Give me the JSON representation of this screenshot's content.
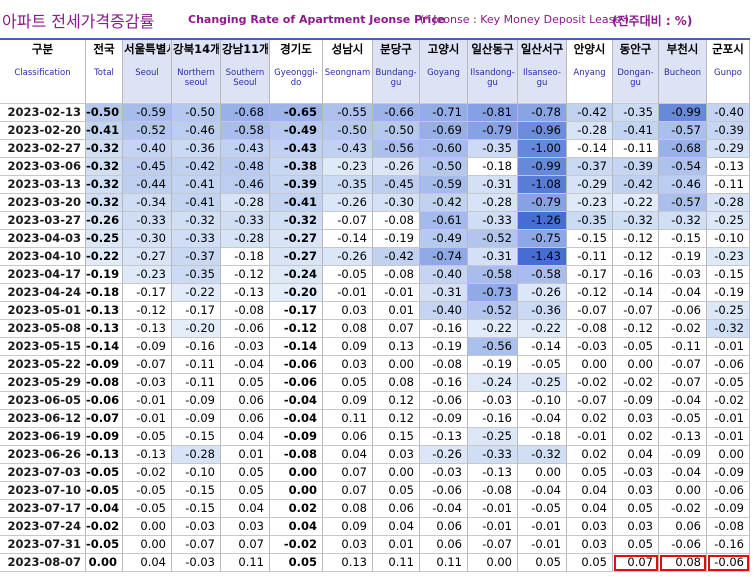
{
  "title": {
    "korean": "아파트 전세가격증감률",
    "english": "Changing Rate of Apartment Jeonse Price",
    "note": "(* Jeonse : Key Money Deposit Lease )",
    "unit": "(전주대비 : %)"
  },
  "colors": {
    "title": "#8b1a8b",
    "header_border": "#4a5fb8",
    "highlight_box": "#e01010"
  },
  "columns": [
    {
      "kr": "구분",
      "en": "Classification"
    },
    {
      "kr": "전국",
      "en": "Total"
    },
    {
      "kr": "서울특별시",
      "en": "Seoul"
    },
    {
      "kr": "강북14개구",
      "en": "Northern seoul"
    },
    {
      "kr": "강남11개구",
      "en": "Southern Seoul"
    },
    {
      "kr": "경기도",
      "en": "Gyeonggi-do"
    },
    {
      "kr": "성남시",
      "en": "Seongnam"
    },
    {
      "kr": "분당구",
      "en": "Bundang-gu"
    },
    {
      "kr": "고양시",
      "en": "Goyang"
    },
    {
      "kr": "일산동구",
      "en": "Ilsandong-gu"
    },
    {
      "kr": "일산서구",
      "en": "Ilsanseo-gu"
    },
    {
      "kr": "안양시",
      "en": "Anyang"
    },
    {
      "kr": "동안구",
      "en": "Dongan-gu"
    },
    {
      "kr": "부천시",
      "en": "Bucheon"
    },
    {
      "kr": "군포시",
      "en": "Gunpo"
    }
  ],
  "rows": [
    {
      "date": "2023-02-13",
      "v": [
        "-0.50",
        "-0.59",
        "-0.50",
        "-0.68",
        "-0.65",
        "-0.55",
        "-0.66",
        "-0.71",
        "-0.81",
        "-0.78",
        "-0.42",
        "-0.35",
        "-0.99",
        "-0.40"
      ]
    },
    {
      "date": "2023-02-20",
      "v": [
        "-0.41",
        "-0.52",
        "-0.46",
        "-0.58",
        "-0.49",
        "-0.50",
        "-0.50",
        "-0.69",
        "-0.79",
        "-0.96",
        "-0.28",
        "-0.41",
        "-0.57",
        "-0.39"
      ]
    },
    {
      "date": "2023-02-27",
      "v": [
        "-0.32",
        "-0.40",
        "-0.36",
        "-0.43",
        "-0.43",
        "-0.43",
        "-0.56",
        "-0.60",
        "-0.35",
        "-1.00",
        "-0.14",
        "-0.11",
        "-0.68",
        "-0.29"
      ]
    },
    {
      "date": "2023-03-06",
      "v": [
        "-0.32",
        "-0.45",
        "-0.42",
        "-0.48",
        "-0.38",
        "-0.23",
        "-0.26",
        "-0.50",
        "-0.18",
        "-0.99",
        "-0.37",
        "-0.39",
        "-0.54",
        "-0.13"
      ]
    },
    {
      "date": "2023-03-13",
      "v": [
        "-0.32",
        "-0.44",
        "-0.41",
        "-0.46",
        "-0.39",
        "-0.35",
        "-0.45",
        "-0.59",
        "-0.31",
        "-1.08",
        "-0.29",
        "-0.42",
        "-0.46",
        "-0.11"
      ]
    },
    {
      "date": "2023-03-20",
      "v": [
        "-0.32",
        "-0.34",
        "-0.41",
        "-0.28",
        "-0.41",
        "-0.26",
        "-0.30",
        "-0.42",
        "-0.28",
        "-0.79",
        "-0.23",
        "-0.22",
        "-0.57",
        "-0.28"
      ]
    },
    {
      "date": "2023-03-27",
      "v": [
        "-0.26",
        "-0.33",
        "-0.32",
        "-0.33",
        "-0.32",
        "-0.07",
        "-0.08",
        "-0.61",
        "-0.33",
        "-1.26",
        "-0.35",
        "-0.32",
        "-0.32",
        "-0.25"
      ]
    },
    {
      "date": "2023-04-03",
      "v": [
        "-0.25",
        "-0.30",
        "-0.33",
        "-0.28",
        "-0.27",
        "-0.14",
        "-0.19",
        "-0.49",
        "-0.52",
        "-0.75",
        "-0.15",
        "-0.12",
        "-0.15",
        "-0.10"
      ]
    },
    {
      "date": "2023-04-10",
      "v": [
        "-0.22",
        "-0.27",
        "-0.37",
        "-0.18",
        "-0.27",
        "-0.26",
        "-0.42",
        "-0.74",
        "-0.31",
        "-1.43",
        "-0.11",
        "-0.12",
        "-0.19",
        "-0.23"
      ]
    },
    {
      "date": "2023-04-17",
      "v": [
        "-0.19",
        "-0.23",
        "-0.35",
        "-0.12",
        "-0.24",
        "-0.05",
        "-0.08",
        "-0.40",
        "-0.58",
        "-0.58",
        "-0.17",
        "-0.16",
        "-0.03",
        "-0.15"
      ]
    },
    {
      "date": "2023-04-24",
      "v": [
        "-0.18",
        "-0.17",
        "-0.22",
        "-0.13",
        "-0.20",
        "-0.01",
        "-0.01",
        "-0.31",
        "-0.73",
        "-0.26",
        "-0.12",
        "-0.14",
        "-0.04",
        "-0.19"
      ]
    },
    {
      "date": "2023-05-01",
      "v": [
        "-0.13",
        "-0.12",
        "-0.17",
        "-0.08",
        "-0.17",
        "0.03",
        "0.01",
        "-0.40",
        "-0.52",
        "-0.36",
        "-0.07",
        "-0.07",
        "-0.06",
        "-0.25"
      ]
    },
    {
      "date": "2023-05-08",
      "v": [
        "-0.13",
        "-0.13",
        "-0.20",
        "-0.06",
        "-0.12",
        "0.08",
        "0.07",
        "-0.16",
        "-0.22",
        "-0.22",
        "-0.08",
        "-0.12",
        "-0.02",
        "-0.32"
      ]
    },
    {
      "date": "2023-05-15",
      "v": [
        "-0.14",
        "-0.09",
        "-0.16",
        "-0.03",
        "-0.14",
        "0.09",
        "0.13",
        "-0.19",
        "-0.56",
        "-0.14",
        "-0.03",
        "-0.05",
        "-0.11",
        "-0.01"
      ]
    },
    {
      "date": "2023-05-22",
      "v": [
        "-0.09",
        "-0.07",
        "-0.11",
        "-0.04",
        "-0.06",
        "0.03",
        "0.00",
        "-0.08",
        "-0.19",
        "-0.05",
        "0.00",
        "0.00",
        "-0.07",
        "-0.06"
      ]
    },
    {
      "date": "2023-05-29",
      "v": [
        "-0.08",
        "-0.03",
        "-0.11",
        "0.05",
        "-0.06",
        "0.05",
        "0.08",
        "-0.16",
        "-0.24",
        "-0.25",
        "-0.02",
        "-0.02",
        "-0.07",
        "-0.05"
      ]
    },
    {
      "date": "2023-06-05",
      "v": [
        "-0.06",
        "-0.01",
        "-0.09",
        "0.06",
        "-0.04",
        "0.09",
        "0.12",
        "-0.06",
        "-0.03",
        "-0.10",
        "-0.07",
        "-0.09",
        "-0.04",
        "-0.02"
      ]
    },
    {
      "date": "2023-06-12",
      "v": [
        "-0.07",
        "-0.01",
        "-0.09",
        "0.06",
        "-0.04",
        "0.11",
        "0.12",
        "-0.09",
        "-0.16",
        "-0.04",
        "0.02",
        "0.03",
        "-0.05",
        "-0.01"
      ]
    },
    {
      "date": "2023-06-19",
      "v": [
        "-0.09",
        "-0.05",
        "-0.15",
        "0.04",
        "-0.09",
        "0.06",
        "0.15",
        "-0.13",
        "-0.25",
        "-0.18",
        "-0.01",
        "0.02",
        "-0.13",
        "-0.01"
      ]
    },
    {
      "date": "2023-06-26",
      "v": [
        "-0.13",
        "-0.13",
        "-0.28",
        "0.01",
        "-0.08",
        "0.04",
        "0.03",
        "-0.26",
        "-0.33",
        "-0.32",
        "0.02",
        "0.04",
        "-0.09",
        "0.00"
      ]
    },
    {
      "date": "2023-07-03",
      "v": [
        "-0.05",
        "-0.02",
        "-0.10",
        "0.05",
        "0.00",
        "0.07",
        "0.00",
        "-0.03",
        "-0.13",
        "0.00",
        "0.05",
        "-0.03",
        "-0.04",
        "-0.09"
      ]
    },
    {
      "date": "2023-07-10",
      "v": [
        "-0.05",
        "-0.05",
        "-0.15",
        "0.05",
        "0.00",
        "0.07",
        "0.05",
        "-0.06",
        "-0.08",
        "-0.04",
        "0.04",
        "0.03",
        "0.00",
        "-0.06"
      ]
    },
    {
      "date": "2023-07-17",
      "v": [
        "-0.04",
        "-0.05",
        "-0.15",
        "0.04",
        "0.02",
        "0.08",
        "0.06",
        "-0.04",
        "-0.01",
        "-0.05",
        "0.04",
        "0.05",
        "-0.02",
        "-0.09"
      ]
    },
    {
      "date": "2023-07-24",
      "v": [
        "-0.02",
        "0.00",
        "-0.03",
        "0.03",
        "0.04",
        "0.09",
        "0.04",
        "0.06",
        "-0.01",
        "-0.01",
        "0.03",
        "0.03",
        "0.06",
        "-0.08"
      ]
    },
    {
      "date": "2023-07-31",
      "v": [
        "-0.05",
        "0.00",
        "-0.07",
        "0.07",
        "-0.02",
        "0.03",
        "0.01",
        "0.06",
        "-0.07",
        "-0.01",
        "0.03",
        "0.05",
        "-0.06",
        "-0.16"
      ]
    },
    {
      "date": "2023-08-07",
      "v": [
        "0.00",
        "0.04",
        "-0.03",
        "0.11",
        "0.05",
        "0.13",
        "0.11",
        "0.11",
        "0.00",
        "0.05",
        "0.05",
        "0.07",
        "0.08",
        "-0.06"
      ]
    }
  ],
  "highlighted_cells": [
    {
      "row": 25,
      "col": 11
    },
    {
      "row": 25,
      "col": 12
    },
    {
      "row": 25,
      "col": 13
    }
  ]
}
